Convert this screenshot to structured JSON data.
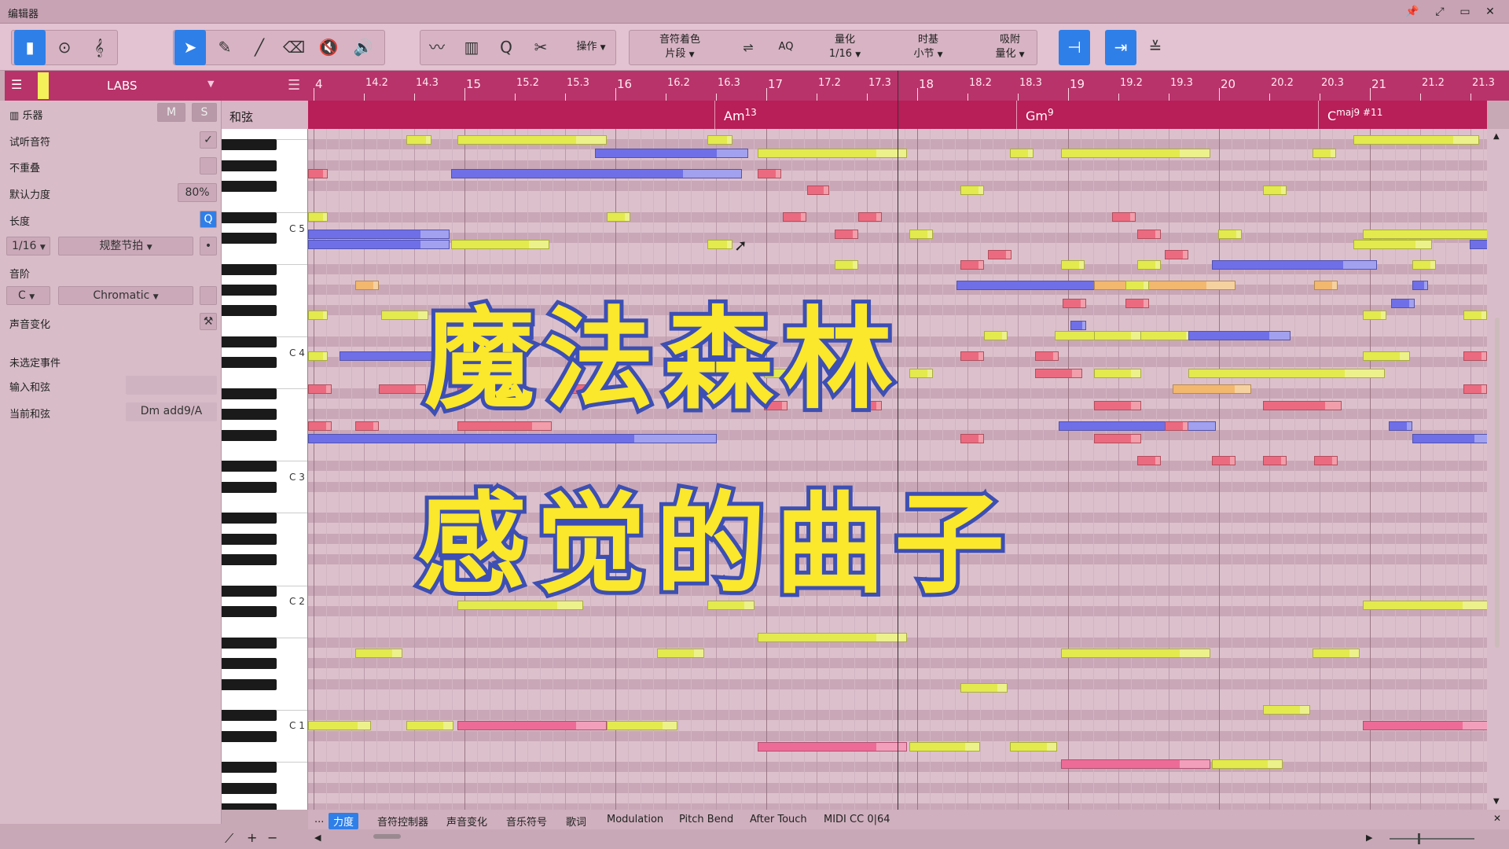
{
  "window": {
    "title": "编辑器",
    "controls": [
      "📌",
      "⤢",
      "▭",
      "✕"
    ]
  },
  "toolbar": {
    "note_color_label": "音符着色",
    "note_color_value": "片段",
    "aq_label": "AQ",
    "quantize_label": "量化",
    "quantize_value": "1/16",
    "timebase_label": "时基",
    "timebase_value": "小节",
    "snap_label": "吸附",
    "snap_value": "量化",
    "operations_label": "操作"
  },
  "track": {
    "name": "LABS"
  },
  "inspector": {
    "instrument_label": "乐器",
    "mute_label": "M",
    "solo_label": "S",
    "audition_label": "试听音符",
    "no_overlap_label": "不重叠",
    "default_velocity_label": "默认力度",
    "default_velocity_value": "80%",
    "length_label": "长度",
    "length_q": "Q",
    "length_value": "1/16",
    "length_mode": "规整节拍",
    "scale_label": "音阶",
    "scale_root": "C",
    "scale_type": "Chromatic",
    "sound_variation_label": "声音变化",
    "no_event_label": "未选定事件",
    "input_chord_label": "输入和弦",
    "current_chord_label": "当前和弦",
    "current_chord_value": "Dm add9/A"
  },
  "chord_track": {
    "label": "和弦",
    "chords": [
      {
        "root": "Am",
        "ext": "13",
        "bar": 17
      },
      {
        "root": "Gm",
        "ext": "9",
        "bar": 19
      },
      {
        "root": "C",
        "ext": "maj9 #11",
        "bar": 21
      }
    ]
  },
  "ruler": {
    "labels": [
      "4",
      "14.2",
      "14.3",
      "15",
      "15.2",
      "15.3",
      "16",
      "16.2",
      "16.3",
      "17",
      "17.2",
      "17.3",
      "18",
      "18.2",
      "18.3",
      "19",
      "19.2",
      "19.3",
      "20",
      "20.2",
      "20.3",
      "21",
      "21.2",
      "21.3"
    ]
  },
  "keyboard": {
    "octave_labels": [
      "C 5",
      "C 4",
      "C 3",
      "C 2",
      "C 1"
    ]
  },
  "bottom_tabs": [
    "...",
    "力度",
    "音符控制器",
    "声音变化",
    "音乐符号",
    "歌词",
    "Modulation",
    "Pitch Bend",
    "After Touch",
    "MIDI CC 0|64"
  ],
  "overlay": {
    "line1": "魔法森林",
    "line2": "感觉的曲子"
  },
  "colors": {
    "accent": "#2f7fe8",
    "ruler": "#b8336a",
    "chord_track": "#b81e57",
    "note_yellow": "#e3ea4e",
    "note_blue": "#6f6fe8",
    "note_red": "#ec6a7f",
    "overlay_text": "#fbe72c",
    "overlay_stroke": "#3d4fb3"
  }
}
